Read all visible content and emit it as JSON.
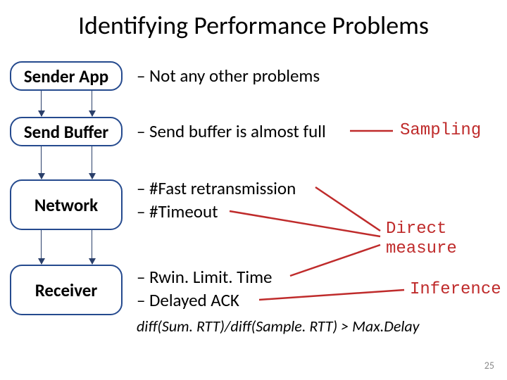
{
  "title": "Identifying Performance Problems",
  "boxes": {
    "sender_app": "Sender App",
    "send_buffer": "Send Buffer",
    "network": "Network",
    "receiver": "Receiver"
  },
  "bullets": {
    "not_any": "Not any other problems",
    "buffer_full": "Send buffer is almost full",
    "fast_retx": "#Fast retransmission",
    "timeout": "#Timeout",
    "rwin": "Rwin. Limit. Time",
    "delayed_ack": "Delayed ACK"
  },
  "labels": {
    "sampling": "Sampling",
    "direct_measure_l1": "Direct",
    "direct_measure_l2": "measure",
    "inference": "Inference"
  },
  "formula": "diff(Sum. RTT)/diff(Sample. RTT) > Max.Delay",
  "page_number": "25"
}
